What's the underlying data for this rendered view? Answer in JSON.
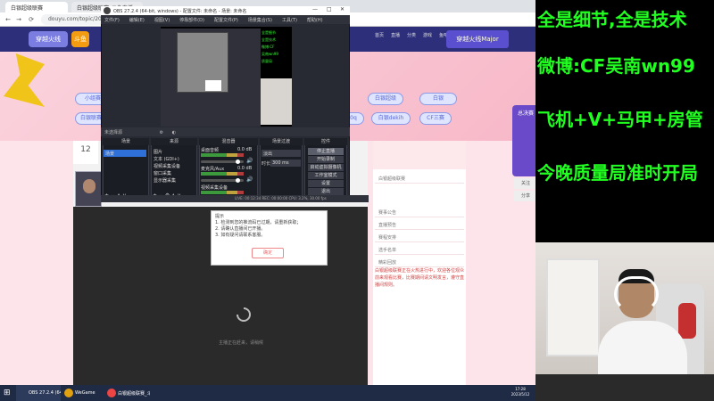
{
  "browser": {
    "tabs": [
      {
        "label": "白银超级联赛"
      },
      {
        "label": "白银超级联赛_斗鱼直播"
      }
    ],
    "address": "douyu.com/topic/2023CF/?r...",
    "site": {
      "logo": "穿越火线Major",
      "logo_tag": "斗鱼",
      "header_icons": [
        "首页",
        "直播",
        "分类",
        "游戏",
        "鱼吧",
        "发现",
        "关注",
        "历史"
      ],
      "banner": "穿越火线Major",
      "pills_row1": [
        "小组赛",
        "淘汰赛",
        "决赛",
        "冠军",
        "白银超级",
        "白银"
      ],
      "pills_row2": [
        "白银联赛",
        "白银0q",
        "白银dekih",
        "CF三赛"
      ],
      "date_day": "12",
      "side_badge": "总决赛",
      "side_buttons": [
        "关注",
        "分享"
      ],
      "player_caption": "主播正在赶来，请稍候"
    },
    "right_panel": {
      "rows": [
        "白银超级联赛",
        "赛事公告",
        "直播预告",
        "赛程安排",
        "选手名单",
        "精彩回放"
      ],
      "announcement": "白银超级联赛正在火热进行中，欢迎各位观众前来观看比赛，比赛期间请文明发言，遵守直播间规则。"
    }
  },
  "obs": {
    "title": "OBS 27.2.4 (64-bit, windows) - 配置文件: 未命名 - 场景: 未命名",
    "menu": [
      "文件(F)",
      "编辑(E)",
      "视图(V)",
      "停靠部件(D)",
      "配置文件(P)",
      "场景集合(S)",
      "工具(T)",
      "帮助(H)"
    ],
    "preview_overlay": [
      "全是细节",
      "全是技术",
      "微博:CF",
      "吴南wn99",
      "质量局"
    ],
    "selected_source_bar": "未选择源",
    "docks": {
      "scenes": {
        "title": "场景",
        "items": [
          "场景"
        ]
      },
      "sources": {
        "title": "来源",
        "items": [
          "图片",
          "文本 (GDI+)",
          "视频采集设备",
          "窗口采集",
          "显示器采集"
        ]
      },
      "mixer": {
        "title": "混音器",
        "channels": [
          {
            "name": "桌面音频",
            "level": "0.0 dB"
          },
          {
            "name": "麦克风/Aux",
            "level": "0.0 dB"
          },
          {
            "name": "视频采集设备",
            "level": "0.0 dB"
          }
        ]
      },
      "transitions": {
        "title": "场景过渡",
        "type": "淡出",
        "duration_label": "时长",
        "duration": "300 ms"
      },
      "controls": {
        "title": "控件",
        "buttons": [
          "停止直播",
          "开始录制",
          "启动虚拟摄像机",
          "工作室模式",
          "设置",
          "退出"
        ]
      }
    },
    "status": "LIVE: 00:12:34  REC: 00:00:00  CPU: 3.2%, 30.00 fps"
  },
  "dialog": {
    "lines": [
      "提示",
      "1. 检测到您的推流码已过期，请重新获取；",
      "2. 请确认直播间已开播。",
      "3. 如有疑问请联系客服。"
    ],
    "button": "确定"
  },
  "taskbar": {
    "items": [
      "OBS 27.2.4 (64-bit)",
      "WeGame",
      "白银超级联赛_斗鱼"
    ],
    "time": "17:28",
    "date": "2023/5/12"
  },
  "overlay": {
    "lines": [
      "全是细节,全是技术",
      "微博:CF吴南wn99",
      "飞机+V+马甲+房管",
      "今晚质量局准时开局"
    ],
    "text_color": "#20ff20"
  }
}
